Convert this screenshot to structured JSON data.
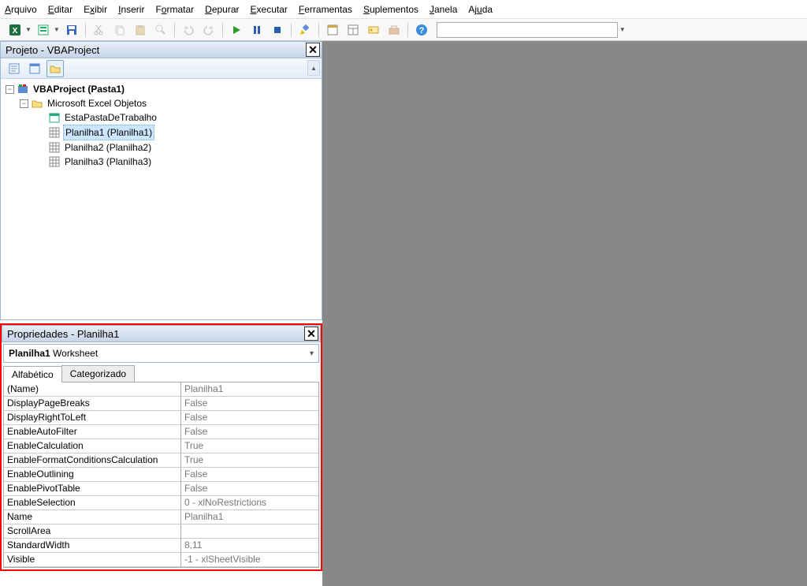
{
  "menu": {
    "items": [
      {
        "pre": "",
        "u": "A",
        "post": "rquivo"
      },
      {
        "pre": "",
        "u": "E",
        "post": "ditar"
      },
      {
        "pre": "E",
        "u": "x",
        "post": "ibir"
      },
      {
        "pre": "",
        "u": "I",
        "post": "nserir"
      },
      {
        "pre": "F",
        "u": "o",
        "post": "rmatar"
      },
      {
        "pre": "",
        "u": "D",
        "post": "epurar"
      },
      {
        "pre": "",
        "u": "E",
        "post": "xecutar"
      },
      {
        "pre": "",
        "u": "F",
        "post": "erramentas"
      },
      {
        "pre": "",
        "u": "S",
        "post": "uplementos"
      },
      {
        "pre": "",
        "u": "J",
        "post": "anela"
      },
      {
        "pre": "Aj",
        "u": "u",
        "post": "da"
      }
    ]
  },
  "projectPanel": {
    "title": "Projeto - VBAProject",
    "root": "VBAProject (Pasta1)",
    "folder": "Microsoft Excel Objetos",
    "items": [
      "EstaPastaDeTrabalho",
      "Planilha1 (Planilha1)",
      "Planilha2 (Planilha2)",
      "Planilha3 (Planilha3)"
    ],
    "selectedIndex": 1
  },
  "propertiesPanel": {
    "title": "Propriedades - Planilha1",
    "objectName": "Planilha1",
    "objectType": "Worksheet",
    "tabs": {
      "alpha": "Alfabético",
      "cat": "Categorizado"
    },
    "rows": [
      {
        "name": "(Name)",
        "value": "Planilha1"
      },
      {
        "name": "DisplayPageBreaks",
        "value": "False"
      },
      {
        "name": "DisplayRightToLeft",
        "value": "False"
      },
      {
        "name": "EnableAutoFilter",
        "value": "False"
      },
      {
        "name": "EnableCalculation",
        "value": "True"
      },
      {
        "name": "EnableFormatConditionsCalculation",
        "value": "True"
      },
      {
        "name": "EnableOutlining",
        "value": "False"
      },
      {
        "name": "EnablePivotTable",
        "value": "False"
      },
      {
        "name": "EnableSelection",
        "value": "0 - xlNoRestrictions"
      },
      {
        "name": "Name",
        "value": "Planilha1"
      },
      {
        "name": "ScrollArea",
        "value": ""
      },
      {
        "name": "StandardWidth",
        "value": "8,11"
      },
      {
        "name": "Visible",
        "value": "-1 - xlSheetVisible"
      }
    ]
  },
  "toolbarIcons": [
    "excel-icon",
    "word-icon",
    "save-icon",
    "cut-icon",
    "copy-icon",
    "paste-icon",
    "find-icon",
    "undo-icon",
    "redo-icon",
    "run-icon",
    "pause-icon",
    "stop-icon",
    "design-icon",
    "project-explorer-icon",
    "properties-icon",
    "object-browser-icon",
    "toolbox-icon",
    "help-icon"
  ]
}
